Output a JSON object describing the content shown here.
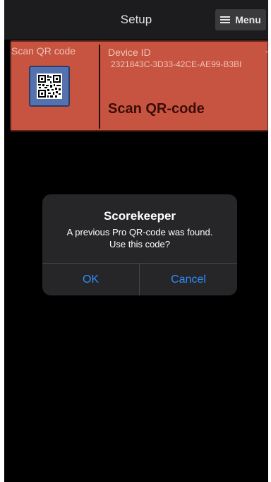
{
  "header": {
    "title": "Setup",
    "menu_label": "Menu",
    "menu_icon": "hamburger-icon"
  },
  "card": {
    "scan_label": "Scan QR code",
    "qr_icon": "qr-code-icon",
    "device_id_label": "Device ID",
    "device_id_value": "2321843C-3D33-42CE-AE99-B3BI",
    "dash": "-",
    "scan_button_label": "Scan QR-code",
    "background_color": "#c65440"
  },
  "dialog": {
    "title": "Scorekeeper",
    "message_line1": "A previous Pro QR-code was found.",
    "message_line2": "Use this code?",
    "ok_label": "OK",
    "cancel_label": "Cancel",
    "button_color": "#2f8cff"
  }
}
